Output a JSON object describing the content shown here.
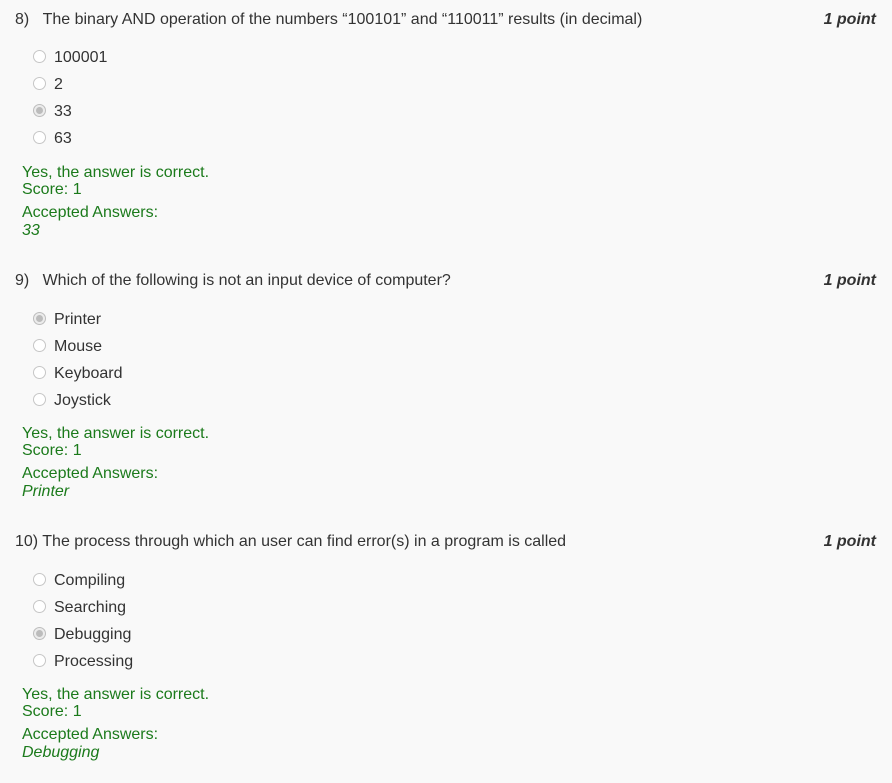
{
  "questions": [
    {
      "number": "8)",
      "text": "The binary AND operation of the numbers “100101” and “110011” results (in decimal)",
      "points": "1 point",
      "options": [
        {
          "label": "100001",
          "selected": false
        },
        {
          "label": "2",
          "selected": false
        },
        {
          "label": "33",
          "selected": true
        },
        {
          "label": "63",
          "selected": false
        }
      ],
      "feedback": "Yes, the answer is correct.",
      "score": "Score: 1",
      "accepted_label": "Accepted Answers:",
      "accepted_answer": "33"
    },
    {
      "number": "9)",
      "text": "Which of the following is not an input device of computer?",
      "points": "1 point",
      "options": [
        {
          "label": "Printer",
          "selected": true
        },
        {
          "label": "Mouse",
          "selected": false
        },
        {
          "label": "Keyboard",
          "selected": false
        },
        {
          "label": "Joystick",
          "selected": false
        }
      ],
      "feedback": "Yes, the answer is correct.",
      "score": "Score: 1",
      "accepted_label": "Accepted Answers:",
      "accepted_answer": "Printer"
    },
    {
      "number": "10)",
      "text": "The process through which an user can find error(s) in a program is called",
      "points": "1 point",
      "options": [
        {
          "label": "Compiling",
          "selected": false
        },
        {
          "label": "Searching",
          "selected": false
        },
        {
          "label": "Debugging",
          "selected": true
        },
        {
          "label": "Processing",
          "selected": false
        }
      ],
      "feedback": "Yes, the answer is correct.",
      "score": "Score: 1",
      "accepted_label": "Accepted Answers:",
      "accepted_answer": "Debugging"
    }
  ],
  "colors": {
    "background": "#f9f9f9",
    "text": "#333333",
    "feedback_green": "#1b7a1b"
  }
}
